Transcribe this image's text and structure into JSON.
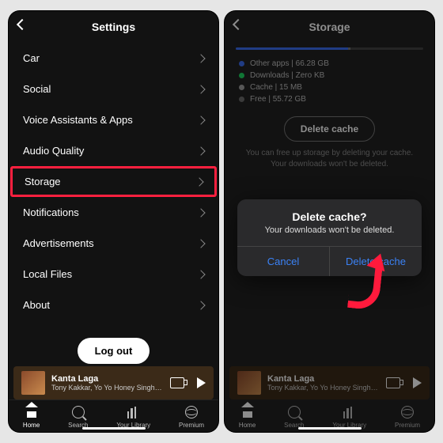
{
  "left": {
    "header": "Settings",
    "items": [
      "Car",
      "Social",
      "Voice Assistants & Apps",
      "Audio Quality",
      "Storage",
      "Notifications",
      "Advertisements",
      "Local Files",
      "About"
    ],
    "highlight_index": 4,
    "logout": "Log out"
  },
  "right": {
    "header": "Storage",
    "legend": [
      {
        "color": "#3a6df0",
        "label": "Other apps",
        "value": "66.28 GB"
      },
      {
        "color": "#1ed760",
        "label": "Downloads",
        "value": "Zero KB"
      },
      {
        "color": "#9e9e9e",
        "label": "Cache",
        "value": "15 MB"
      },
      {
        "color": "#6b6b6b",
        "label": "Free",
        "value": "55.72 GB"
      }
    ],
    "delete_btn": "Delete cache",
    "note": "You can free up storage by deleting your cache. Your downloads won't be deleted.",
    "dialog": {
      "title": "Delete cache?",
      "msg": "Your downloads won't be deleted.",
      "cancel": "Cancel",
      "confirm": "Delete cache"
    }
  },
  "nowplaying": {
    "title": "Kanta Laga",
    "artist": "Tony Kakkar, Yo Yo Honey Singh, Neha Ka"
  },
  "nav": [
    "Home",
    "Search",
    "Your Library",
    "Premium"
  ]
}
